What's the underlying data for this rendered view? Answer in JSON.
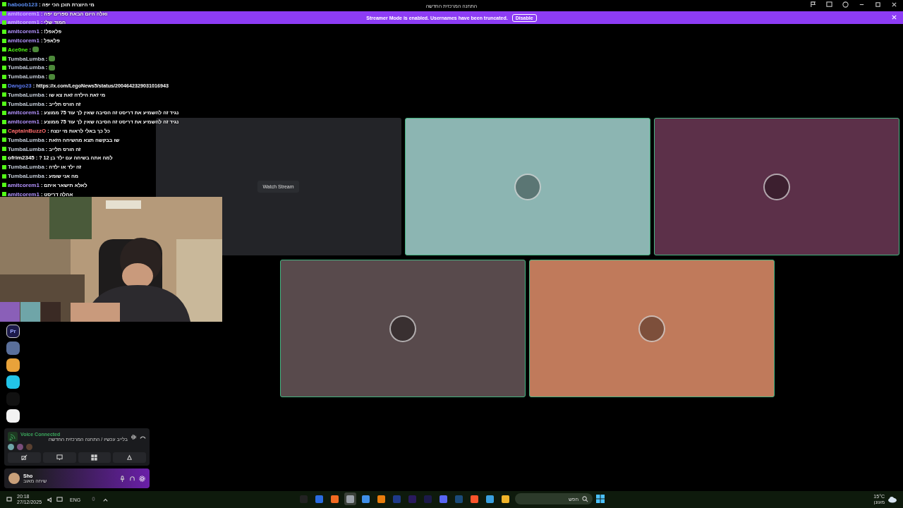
{
  "window": {
    "title": "התחנה המרכזית החדשה"
  },
  "banner": {
    "text": "Streamer Mode is enabled. Usernames have been truncated.",
    "button": "Disable"
  },
  "chat": [
    {
      "user": "haboob123",
      "sep": ":",
      "color": "#5a8cf0",
      "kind": "text",
      "text": "מי היוצרת תוכן הכי יפה"
    },
    {
      "user": "amitcorem1",
      "sep": ":",
      "color": "#c9b4ff",
      "kind": "text",
      "text": "ואלה היום הבאת ספרים יפה"
    },
    {
      "user": "amitcorem1",
      "sep": ":",
      "color": "#c9b4ff",
      "kind": "text",
      "text": "חמוד שלי"
    },
    {
      "user": "amitcorem1",
      "sep": ":",
      "color": "#b493ff",
      "kind": "text",
      "text": "פלאפל!"
    },
    {
      "user": "amitcorem1",
      "sep": ":",
      "color": "#b493ff",
      "kind": "text",
      "text": "פלאפל"
    },
    {
      "user": "Ace0ne",
      "sep": ":",
      "color": "#53fc18",
      "kind": "emote"
    },
    {
      "user": "TumbaLumba",
      "sep": ":",
      "color": "#c4ccd8",
      "kind": "emote"
    },
    {
      "user": "TumbaLumba",
      "sep": ":",
      "color": "#c4ccd8",
      "kind": "emote"
    },
    {
      "user": "TumbaLumba",
      "sep": ":",
      "color": "#c4ccd8",
      "kind": "emote"
    },
    {
      "user": "Dango23",
      "sep": ":",
      "color": "#5a78f0",
      "kind": "text",
      "text": "https://x.com/LegoNews5/status/2004642329031016943"
    },
    {
      "user": "TumbaLumba",
      "sep": ":",
      "color": "#c4ccd8",
      "kind": "text",
      "text": "מי זאת הילדה זאת צא שו"
    },
    {
      "user": "TumbaLumba",
      "sep": ":",
      "color": "#c4ccd8",
      "kind": "text",
      "text": "זה הורס תלייב"
    },
    {
      "user": "amitcorem1",
      "sep": ":",
      "color": "#b493ff",
      "kind": "text",
      "text": "נגיד זה להשמיע את דריסט זה הסיבה שאין לך עוד 75 ממוצע"
    },
    {
      "user": "amitcorem1",
      "sep": ":",
      "color": "#b493ff",
      "kind": "text",
      "text": "נגיד זה להשמיע את דריסט זה הסיבה שאין לך עוד 75 ממוצע"
    },
    {
      "user": "CaptainBuzzO",
      "sep": ":",
      "color": "#ff6b6b",
      "kind": "text",
      "text": "כל כך באלי לראות מי ינצח"
    },
    {
      "user": "TumbaLumba",
      "sep": ":",
      "color": "#c4ccd8",
      "kind": "text",
      "text": "שו בבקשה תצא מהשיחה הזאת"
    },
    {
      "user": "TumbaLumba",
      "sep": ":",
      "color": "#c4ccd8",
      "kind": "text",
      "text": "זה הורס תלייב"
    },
    {
      "user": "ofrim2345",
      "sep": ":",
      "color": "#ffffff",
      "kind": "text",
      "text": "למה אתה בשיחה עם ילד בן 12 ?"
    },
    {
      "user": "TumbaLumba",
      "sep": ":",
      "color": "#c4ccd8",
      "kind": "text",
      "text": "זה ילד או ילדה"
    },
    {
      "user": "TumbaLumba",
      "sep": ":",
      "color": "#c4ccd8",
      "kind": "text",
      "text": "מה אני שומע"
    },
    {
      "user": "amitcorem1",
      "sep": ":",
      "color": "#b493ff",
      "kind": "text",
      "text": "לאלא תישאר איתם"
    },
    {
      "user": "amitcorem1",
      "sep": ":",
      "color": "#b493ff",
      "kind": "text",
      "text": "אחלה דריסט"
    }
  ],
  "cam_avatars": [
    {
      "color": "#8a5fb8"
    },
    {
      "color": "#6fa5a8"
    },
    {
      "color": "#3a2a24"
    }
  ],
  "servers": [
    {
      "kind": "label",
      "text": "Pr",
      "color": "#1c1a4a"
    },
    {
      "kind": "avatar",
      "color": "#5a6f9a"
    },
    {
      "kind": "avatar",
      "color": "#e8a23a"
    },
    {
      "kind": "avatar",
      "color": "#22c4e8"
    },
    {
      "kind": "avatar",
      "color": "#111111"
    },
    {
      "kind": "avatar",
      "color": "#f2f2f2"
    }
  ],
  "voice": {
    "status": "Voice Connected",
    "location": "בלייב עכשיו / התחנה המרכזית החדשה",
    "members": [
      {
        "color": "#6fa5a8"
      },
      {
        "color": "#7a4e7a"
      },
      {
        "color": "#5a4030"
      }
    ]
  },
  "user": {
    "name": "Sho",
    "status": "שיחה מאוב"
  },
  "tiles": [
    [
      {
        "kind": "stream",
        "button": "Watch Stream"
      },
      {
        "kind": "user",
        "color": "#8cb5b2",
        "speaking": true
      },
      {
        "kind": "user",
        "color": "#5c3049",
        "speaking": true
      }
    ],
    [
      {
        "kind": "user",
        "color": "#584a4c",
        "speaking": true
      },
      {
        "kind": "user",
        "color": "#c07a5b",
        "speaking": true
      }
    ]
  ],
  "taskbar": {
    "time": "20:18",
    "date": "27/12/2025",
    "lang": "ENG",
    "search": "חפש",
    "temp": "15°C",
    "weather": "מעונן",
    "apps": [
      {
        "color": "#222222",
        "selected": false
      },
      {
        "color": "#2a6be0",
        "selected": false
      },
      {
        "color": "#f26a21",
        "selected": false
      },
      {
        "color": "#9aa0a8",
        "selected": true
      },
      {
        "color": "#3f8fe8",
        "selected": false
      },
      {
        "color": "#e87d0d",
        "selected": false
      },
      {
        "color": "#1f3a8a",
        "selected": false
      },
      {
        "color": "#2a1a5e",
        "selected": false
      },
      {
        "color": "#1c1a4a",
        "selected": false
      },
      {
        "color": "#5865f2",
        "selected": false
      },
      {
        "color": "#1b4b7a",
        "selected": false
      },
      {
        "color": "#fb542b",
        "selected": false
      },
      {
        "color": "#3aa0e0",
        "selected": false
      },
      {
        "color": "#f0b429",
        "selected": false
      }
    ]
  }
}
